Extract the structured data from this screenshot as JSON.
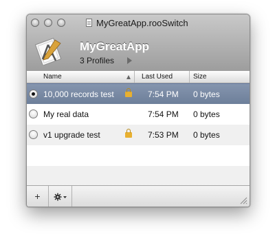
{
  "window": {
    "title": "MyGreatApp.rooSwitch",
    "app_name": "MyGreatApp",
    "profiles_count_label": "3 Profiles"
  },
  "table": {
    "headers": {
      "name": "Name",
      "last_used": "Last Used",
      "size": "Size"
    },
    "rows": [
      {
        "name": "10,000 records test",
        "locked": true,
        "last_used": "7:54 PM",
        "size": "0 bytes",
        "selected": true
      },
      {
        "name": "My real data",
        "locked": false,
        "last_used": "7:54 PM",
        "size": "0 bytes",
        "selected": false
      },
      {
        "name": "v1 upgrade test",
        "locked": true,
        "last_used": "7:53 PM",
        "size": "0 bytes",
        "selected": false
      }
    ]
  },
  "toolbar": {
    "add_label": "+",
    "action_icon": "gear-icon"
  },
  "colors": {
    "selection": "#6d7f9a",
    "lock": "#e8b030",
    "titlebar": "#b3b3b3"
  }
}
